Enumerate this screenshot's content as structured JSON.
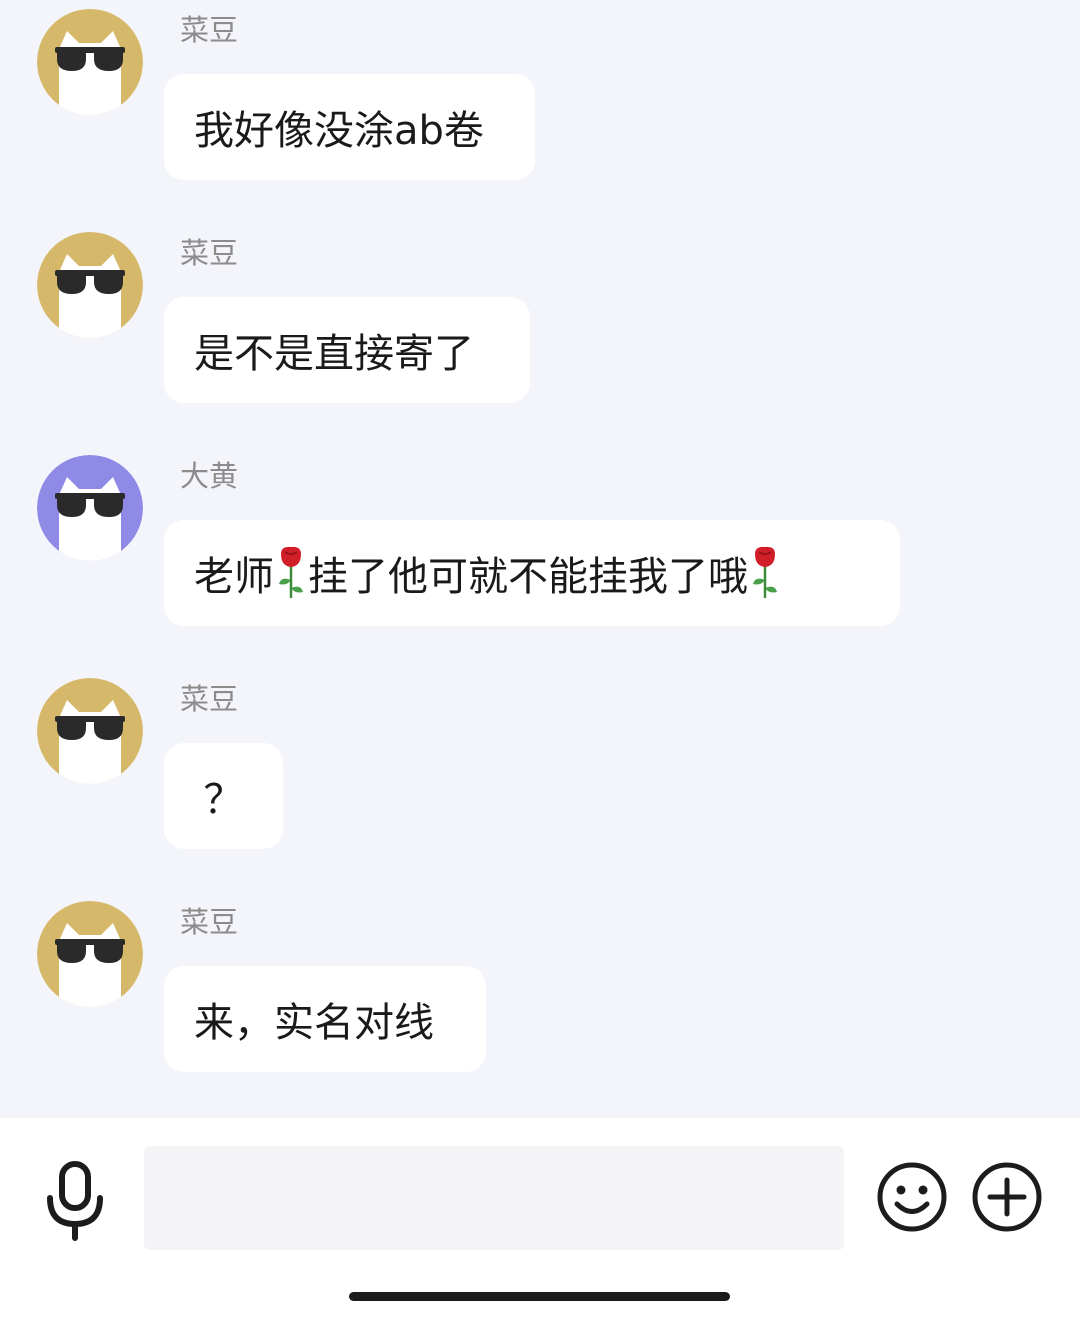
{
  "colors": {
    "avatar_yellow": "#d6b86a",
    "avatar_purple": "#8f8ae6",
    "background": "#f4f5fa",
    "bubble": "#ffffff"
  },
  "messages": [
    {
      "sender": "菜豆",
      "avatar": "sunglasses-cat-yellow",
      "parts": [
        "我好像没涂ab卷"
      ]
    },
    {
      "sender": "菜豆",
      "avatar": "sunglasses-cat-yellow",
      "parts": [
        "是不是直接寄了"
      ]
    },
    {
      "sender": "大黄",
      "avatar": "sunglasses-cat-purple",
      "parts": [
        "老师",
        "挂了他可就不能挂我了哦",
        ""
      ]
    },
    {
      "sender": "菜豆",
      "avatar": "sunglasses-cat-yellow",
      "parts": [
        "？"
      ]
    },
    {
      "sender": "菜豆",
      "avatar": "sunglasses-cat-yellow",
      "parts": [
        "来，实名对线"
      ]
    }
  ],
  "input_bar": {
    "left_icon": "microphone-icon",
    "right_icons": [
      "emoji-icon",
      "plus-icon"
    ],
    "input_value": ""
  }
}
